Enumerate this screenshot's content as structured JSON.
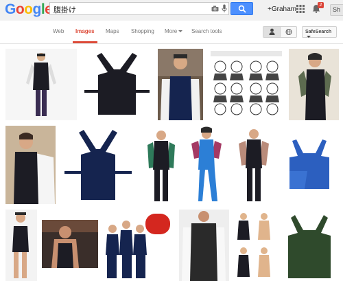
{
  "header": {
    "logo_letters": [
      "G",
      "o",
      "o",
      "g",
      "l",
      "e"
    ],
    "logo_colors": [
      "#4285f4",
      "#ea4335",
      "#fbbc05",
      "#4285f4",
      "#34a853",
      "#ea4335"
    ],
    "query": "腹掛け",
    "user_name": "+Graham",
    "notification_count": "2",
    "share_label": "Sh"
  },
  "nav": {
    "tabs": [
      {
        "label": "Web"
      },
      {
        "label": "Images",
        "active": true
      },
      {
        "label": "Maps"
      },
      {
        "label": "Shopping"
      },
      {
        "label": "More"
      },
      {
        "label": "Search tools"
      }
    ],
    "safesearch_label": "SafeSearch"
  },
  "colors": {
    "accent_red": "#dd4b39",
    "search_blue": "#4d90fe",
    "garment_dark": "#1c1c24",
    "garment_navy": "#15244f",
    "garment_blue": "#2c7fd6",
    "garment_green": "#2f4a2c"
  },
  "results": {
    "rows": [
      [
        {
          "subject": "man-in-dark-apron"
        },
        {
          "subject": "black-haragake-flat"
        },
        {
          "subject": "man-wearing-haragake"
        },
        {
          "subject": "illustrated-instructions"
        },
        {
          "subject": "woman-in-apron-tattoo-sleeves"
        }
      ],
      [
        {
          "subject": "woman-tying-apron"
        },
        {
          "subject": "navy-haragake-flat"
        },
        {
          "subject": "man-floral-sleeves"
        },
        {
          "subject": "woman-blue-outfit"
        },
        {
          "subject": "man-dark-outfit"
        },
        {
          "subject": "blue-apron-flat"
        }
      ],
      [
        {
          "subject": "boy-in-apron"
        },
        {
          "subject": "shirtless-man-festival"
        },
        {
          "subject": "group-festival-photo"
        },
        {
          "subject": "man-mesh-apron"
        },
        {
          "subject": "women-apron-grid"
        },
        {
          "subject": "green-apron-flat"
        }
      ]
    ]
  }
}
